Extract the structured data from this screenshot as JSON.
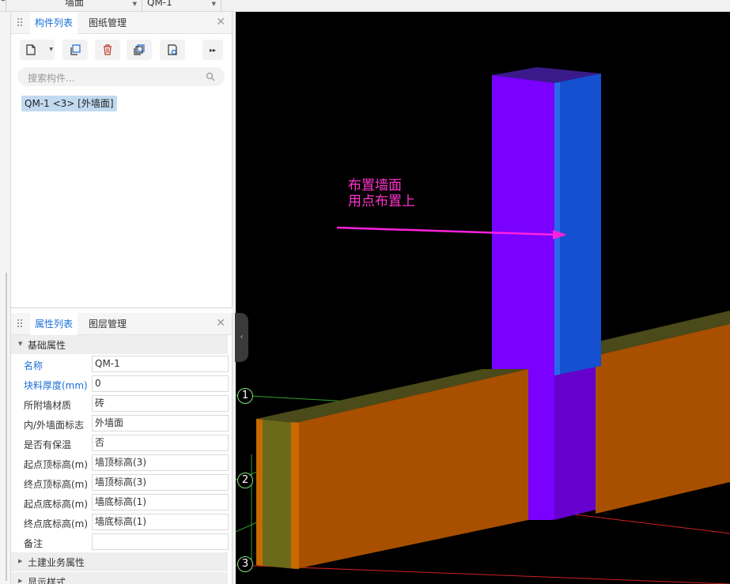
{
  "topbar": {
    "dropdown1": "墙面",
    "dropdown2": "QM-1"
  },
  "component_panel": {
    "tabs": [
      "构件列表",
      "图纸管理"
    ],
    "toolbar_icons": [
      "new-component-icon",
      "copy-component-icon",
      "delete-icon",
      "copy-to-floor-icon",
      "save-template-icon",
      "more-icon"
    ],
    "search_placeholder": "搜索构件...",
    "items": [
      "QM-1 <3> [外墙面]"
    ]
  },
  "property_panel": {
    "tabs": [
      "属性列表",
      "图层管理"
    ],
    "section_basic": "基础属性",
    "rows": [
      {
        "name": "名称",
        "value": "QM-1",
        "highlight": true
      },
      {
        "name": "块料厚度(mm)",
        "value": "0",
        "highlight": true
      },
      {
        "name": "所附墙材质",
        "value": "砖",
        "highlight": false
      },
      {
        "name": "内/外墙面标志",
        "value": "外墙面",
        "highlight": false
      },
      {
        "name": "是否有保温",
        "value": "否",
        "highlight": false
      },
      {
        "name": "起点顶标高(m)",
        "value": "墙顶标高(3)",
        "highlight": false
      },
      {
        "name": "终点顶标高(m)",
        "value": "墙顶标高(3)",
        "highlight": false
      },
      {
        "name": "起点底标高(m)",
        "value": "墙底标高(1)",
        "highlight": false
      },
      {
        "name": "终点底标高(m)",
        "value": "墙底标高(1)",
        "highlight": false
      },
      {
        "name": "备注",
        "value": "",
        "highlight": false
      }
    ],
    "sections_collapsed": [
      "土建业务属性",
      "显示样式"
    ]
  },
  "viewport": {
    "annotation_line1": "布置墙面",
    "annotation_line2": "用点布置上",
    "axis_labels": [
      "1",
      "2",
      "3"
    ],
    "colors": {
      "background": "#000000",
      "column_front": "#7a00ff",
      "column_side": "#1450d0",
      "wall_face": "#a85000",
      "wall_end": "#6a6a1a",
      "annotation": "#ff33cc"
    }
  }
}
